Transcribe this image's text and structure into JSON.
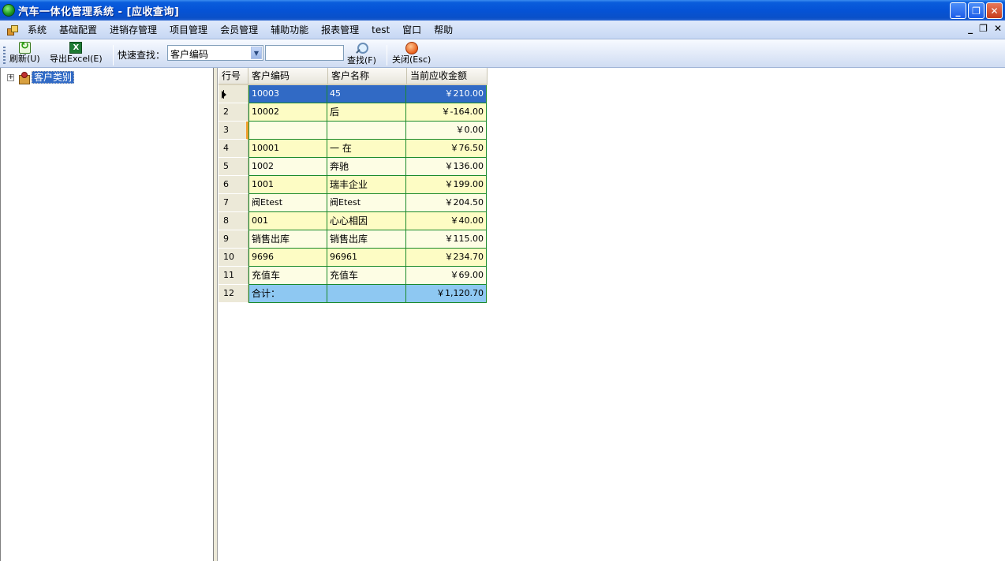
{
  "window": {
    "title": "汽车一体化管理系统 - [应收查询]",
    "minimize": "_",
    "restore": "❐",
    "close": "✕"
  },
  "menu": {
    "items": [
      "系统",
      "基础配置",
      "进销存管理",
      "项目管理",
      "会员管理",
      "辅助功能",
      "报表管理",
      "test",
      "窗口",
      "帮助"
    ],
    "mdi_minimize": "_",
    "mdi_restore": "❐",
    "mdi_close": "✕"
  },
  "toolbar": {
    "refresh": "刷新(U)",
    "export_excel": "导出Excel(E)",
    "quick_search_label": "快速查找：",
    "search_field_selected": "客户编码",
    "search_value": "",
    "find": "查找(F)",
    "close": "关闭(Esc)"
  },
  "tree": {
    "root_label": "客户类别",
    "expander": "+"
  },
  "grid": {
    "columns": [
      "行号",
      "客户编码",
      "客户名称",
      "当前应收金额"
    ],
    "rows": [
      {
        "row": "1",
        "code": "10003",
        "name": "45",
        "amount": "￥210.00"
      },
      {
        "row": "2",
        "code": "10002",
        "name": "后",
        "amount": "￥-164.00"
      },
      {
        "row": "3",
        "code": "",
        "name": "",
        "amount": "￥0.00"
      },
      {
        "row": "4",
        "code": "10001",
        "name": "一 在",
        "amount": "￥76.50"
      },
      {
        "row": "5",
        "code": "1002",
        "name": "奔驰",
        "amount": "￥136.00"
      },
      {
        "row": "6",
        "code": "1001",
        "name": "瑞丰企业",
        "amount": "￥199.00"
      },
      {
        "row": "7",
        "code": "阀Etest",
        "name": "阀Etest",
        "amount": "￥204.50"
      },
      {
        "row": "8",
        "code": "001",
        "name": "心心相因",
        "amount": "￥40.00"
      },
      {
        "row": "9",
        "code": "销售出库",
        "name": "销售出库",
        "amount": "￥115.00"
      },
      {
        "row": "10",
        "code": "9696",
        "name": "96961",
        "amount": "￥234.70"
      },
      {
        "row": "11",
        "code": "充值车",
        "name": "充值车",
        "amount": "￥69.00"
      },
      {
        "row": "12",
        "code": "合计：",
        "name": "",
        "amount": "￥1,120.70"
      }
    ]
  }
}
